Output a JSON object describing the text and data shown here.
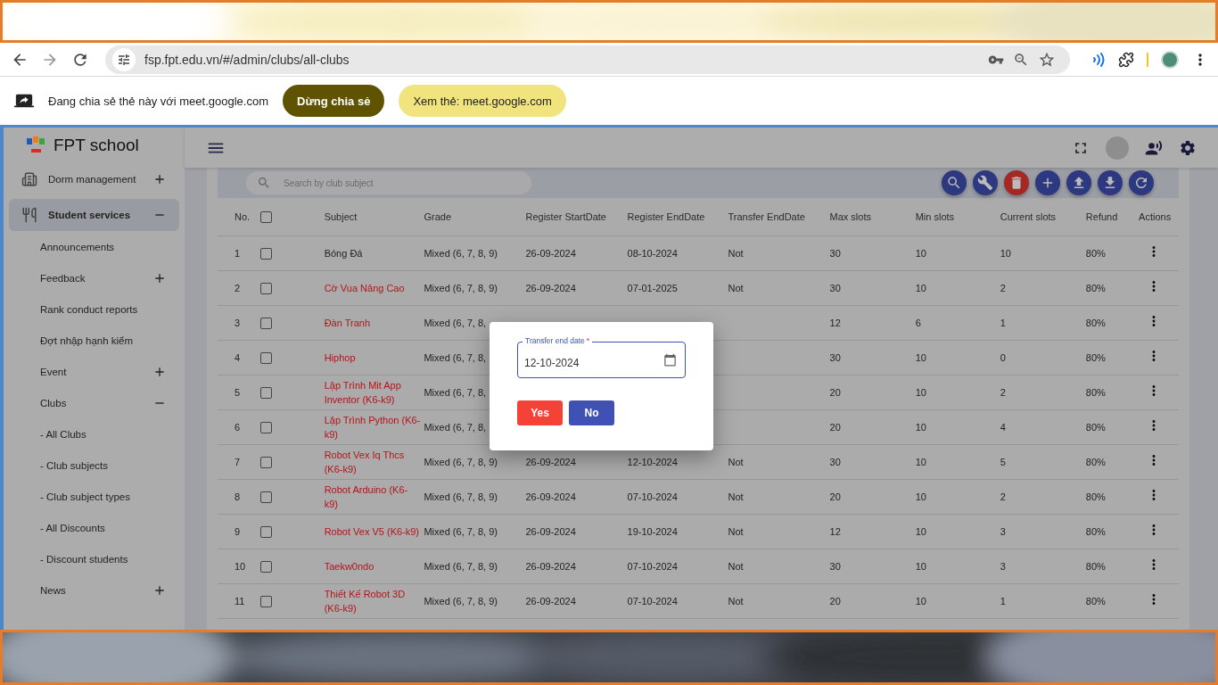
{
  "browser": {
    "url": "fsp.fpt.edu.vn/#/admin/clubs/all-clubs"
  },
  "share_bar": {
    "message": "Đang chia sẻ thẻ này với meet.google.com",
    "stop_button": "Dừng chia sẻ",
    "view_button": "Xem thẻ: meet.google.com"
  },
  "app": {
    "brand": "FPT school"
  },
  "sidebar": {
    "items": [
      {
        "label": "Dorm management",
        "selected": false,
        "expanded": false
      },
      {
        "label": "Student services",
        "selected": true,
        "expanded": true,
        "children": [
          {
            "label": "Announcements",
            "selected": false
          },
          {
            "label": "Feedback",
            "selected": false,
            "expanded": false
          },
          {
            "label": "Rank conduct reports",
            "selected": false
          },
          {
            "label": "Đợt nhập hạnh kiểm",
            "selected": false
          },
          {
            "label": "Event",
            "selected": false,
            "expanded": false
          },
          {
            "label": "Clubs",
            "selected": false,
            "expanded": true,
            "children": [
              {
                "label": "- All Clubs",
                "selected": false
              },
              {
                "label": "- Club subjects",
                "selected": false
              },
              {
                "label": "- Club subject types",
                "selected": false
              },
              {
                "label": "- All Discounts",
                "selected": false
              },
              {
                "label": "- Discount students",
                "selected": false
              }
            ]
          },
          {
            "label": "News",
            "selected": false,
            "expanded": false
          }
        ]
      }
    ]
  },
  "search": {
    "placeholder": "Search by club subject"
  },
  "toolbar": [
    {
      "kind": "search"
    },
    {
      "kind": "edit"
    },
    {
      "kind": "delete"
    },
    {
      "kind": "add"
    },
    {
      "kind": "upload"
    },
    {
      "kind": "download"
    },
    {
      "kind": "refresh"
    }
  ],
  "table": {
    "columns": [
      "No.",
      "Subject",
      "Grade",
      "Register StartDate",
      "Register EndDate",
      "Transfer EndDate",
      "Max slots",
      "Min slots",
      "Current slots",
      "Refund",
      "Actions"
    ],
    "header_checked": false,
    "rows": [
      {
        "no": "1",
        "checked": false,
        "subject": "Bóng Đá",
        "color": "#1e1e1e",
        "grade": "Mixed (6, 7, 8, 9)",
        "start": "26-09-2024",
        "end": "08-10-2024",
        "transfer": "Not",
        "max": "30",
        "min": "10",
        "current": "10",
        "refund": "80%"
      },
      {
        "no": "2",
        "checked": false,
        "subject": "Cờ Vua Nâng Cao",
        "color": "#b3141a",
        "grade": "Mixed (6, 7, 8, 9)",
        "start": "26-09-2024",
        "end": "07-01-2025",
        "transfer": "Not",
        "max": "30",
        "min": "10",
        "current": "2",
        "refund": "80%"
      },
      {
        "no": "3",
        "checked": false,
        "subject": "Đàn Tranh",
        "color": "#b3141a",
        "grade": "Mixed (6, 7, 8,",
        "max": "12",
        "min": "6",
        "current": "1",
        "refund": "80%"
      },
      {
        "no": "4",
        "checked": false,
        "subject": "Hiphop",
        "color": "#b3141a",
        "grade": "Mixed (6, 7, 8,",
        "max": "30",
        "min": "10",
        "current": "0",
        "refund": "80%"
      },
      {
        "no": "5",
        "checked": false,
        "subject": "Lập Trình Mit App Inventor (K6-k9)",
        "color": "#b3141a",
        "grade": "Mixed (6, 7, 8,",
        "max": "20",
        "min": "10",
        "current": "2",
        "refund": "80%"
      },
      {
        "no": "6",
        "checked": false,
        "subject": "Lập Trình Python (K6-k9)",
        "color": "#b3141a",
        "grade": "Mixed (6, 7, 8,",
        "max": "20",
        "min": "10",
        "current": "4",
        "refund": "80%"
      },
      {
        "no": "7",
        "checked": false,
        "subject": "Robot Vex Iq Thcs (K6-k9)",
        "color": "#b3141a",
        "grade": "Mixed (6, 7, 8, 9)",
        "start": "26-09-2024",
        "end": "12-10-2024",
        "transfer": "Not",
        "max": "30",
        "min": "10",
        "current": "5",
        "refund": "80%"
      },
      {
        "no": "8",
        "checked": false,
        "subject": "Robot Arduino (K6-k9)",
        "color": "#b3141a",
        "grade": "Mixed (6, 7, 8, 9)",
        "start": "26-09-2024",
        "end": "07-10-2024",
        "transfer": "Not",
        "max": "20",
        "min": "10",
        "current": "2",
        "refund": "80%"
      },
      {
        "no": "9",
        "checked": false,
        "subject": "Robot Vex V5 (K6-k9)",
        "color": "#b3141a",
        "grade": "Mixed (6, 7, 8, 9)",
        "start": "26-09-2024",
        "end": "19-10-2024",
        "transfer": "Not",
        "max": "12",
        "min": "10",
        "current": "3",
        "refund": "80%"
      },
      {
        "no": "10",
        "checked": false,
        "subject": "Taekw0ndo",
        "color": "#b3141a",
        "grade": "Mixed (6, 7, 8, 9)",
        "start": "26-09-2024",
        "end": "07-10-2024",
        "transfer": "Not",
        "max": "30",
        "min": "10",
        "current": "3",
        "refund": "80%"
      },
      {
        "no": "11",
        "checked": false,
        "subject": "Thiết Kế Robot 3D (K6-k9)",
        "color": "#b3141a",
        "grade": "Mixed (6, 7, 8, 9)",
        "start": "26-09-2024",
        "end": "07-10-2024",
        "transfer": "Not",
        "max": "20",
        "min": "10",
        "current": "1",
        "refund": "80%"
      }
    ]
  },
  "dialog": {
    "field_label": "Transfer end date",
    "required_mark": "*",
    "value": "12-10-2024",
    "yes": "Yes",
    "no": "No"
  }
}
